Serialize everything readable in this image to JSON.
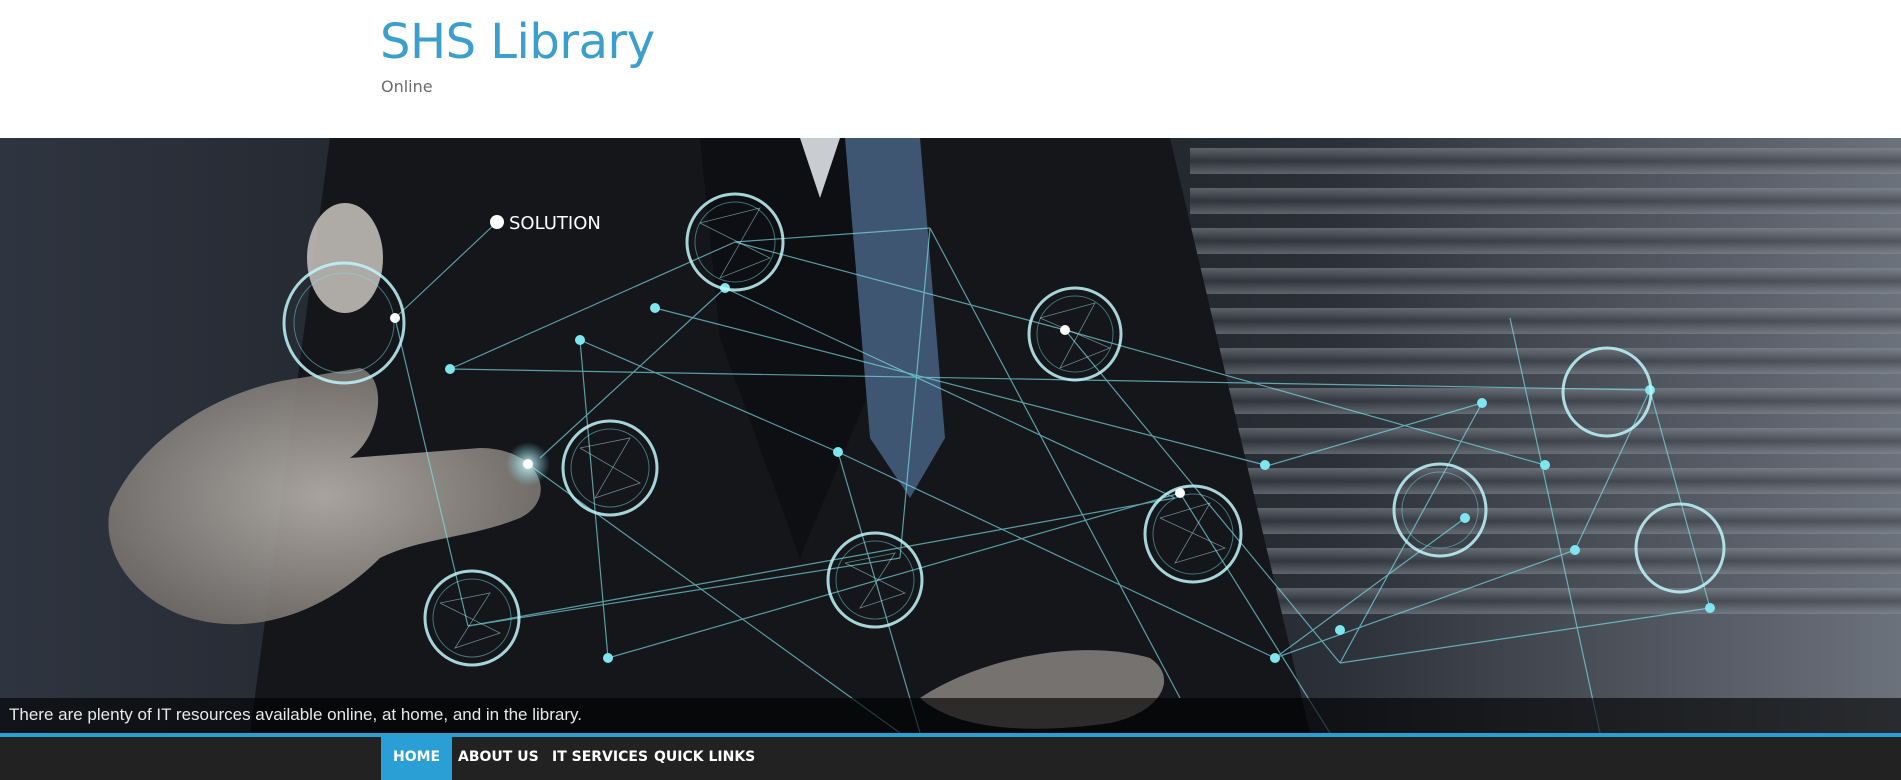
{
  "site": {
    "title": "SHS Library",
    "tagline": "Online"
  },
  "hero": {
    "overlay_label": "SOLUTION",
    "caption": "There are plenty of IT resources available online, at home, and in the library."
  },
  "nav": {
    "items": [
      {
        "label": "HOME",
        "active": true
      },
      {
        "label": "ABOUT US",
        "active": false
      },
      {
        "label": "IT SERVICES",
        "active": false
      },
      {
        "label": "QUICK LINKS",
        "active": false
      }
    ]
  },
  "colors": {
    "accent": "#2a9fd6",
    "title": "#3a9ecf",
    "nav_bg": "#222222",
    "network": "#7fe6f0"
  }
}
